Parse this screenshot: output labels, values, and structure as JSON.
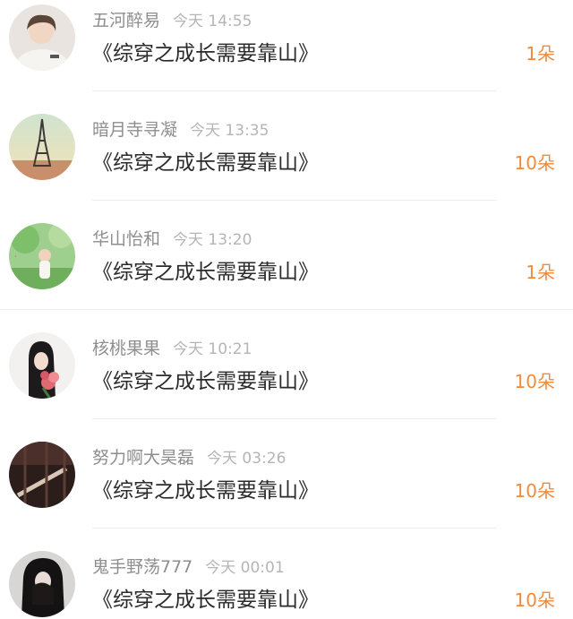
{
  "entries": [
    {
      "user": "五河醉易",
      "time": "今天  14:55",
      "title": "《综穿之成长需要靠山》",
      "gift": "1朵"
    },
    {
      "user": "暗月寺寻凝",
      "time": "今天  13:35",
      "title": "《综穿之成长需要靠山》",
      "gift": "10朵"
    },
    {
      "user": "华山怡和",
      "time": "今天  13:20",
      "title": "《综穿之成长需要靠山》",
      "gift": "1朵"
    },
    {
      "user": "核桃果果",
      "time": "今天  10:21",
      "title": "《综穿之成长需要靠山》",
      "gift": "10朵"
    },
    {
      "user": "努力啊大昊磊",
      "time": "今天  03:26",
      "title": "《综穿之成长需要靠山》",
      "gift": "10朵"
    },
    {
      "user": "鬼手野荡777",
      "time": "今天  00:01",
      "title": "《综穿之成长需要靠山》",
      "gift": "10朵"
    }
  ]
}
